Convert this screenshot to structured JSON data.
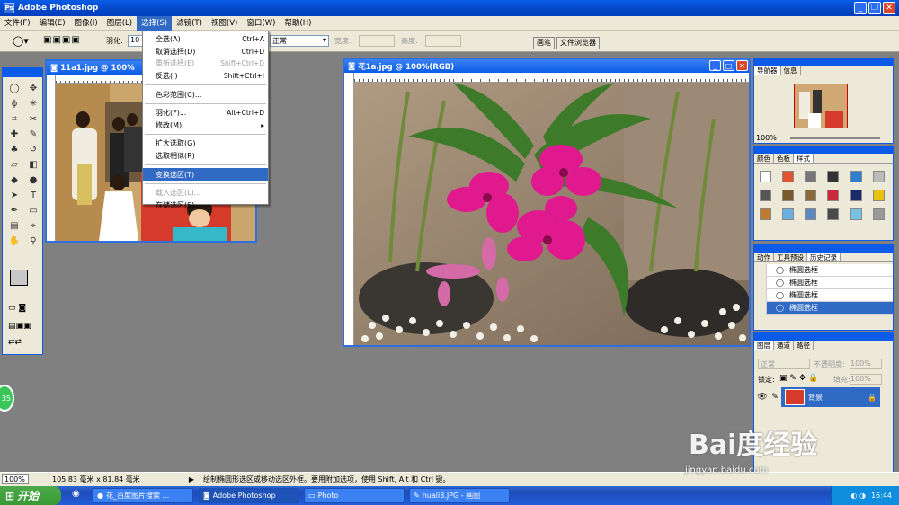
{
  "window": {
    "title": "Adobe Photoshop"
  },
  "menubar": [
    "文件(F)",
    "编辑(E)",
    "图像(I)",
    "图层(L)",
    "选择(S)",
    "滤镜(T)",
    "视图(V)",
    "窗口(W)",
    "帮助(H)"
  ],
  "options": {
    "feather_label": "羽化:",
    "feather_value": "10",
    "style_value": "正常",
    "width_label": "宽度:",
    "height_label": "高度:",
    "well_tabs": [
      "画笔",
      "文件浏览器"
    ]
  },
  "select_menu": [
    {
      "label": "全选(A)",
      "shortcut": "Ctrl+A",
      "disabled": false
    },
    {
      "label": "取消选择(D)",
      "shortcut": "Ctrl+D",
      "disabled": false
    },
    {
      "label": "重新选择(E)",
      "shortcut": "Shift+Ctrl+D",
      "disabled": true
    },
    {
      "label": "反选(I)",
      "shortcut": "Shift+Ctrl+I",
      "disabled": false
    },
    {
      "sep": true
    },
    {
      "label": "色彩范围(C)...",
      "shortcut": "",
      "disabled": false
    },
    {
      "sep": true
    },
    {
      "label": "羽化(F)...",
      "shortcut": "Alt+Ctrl+D",
      "disabled": false
    },
    {
      "label": "修改(M)",
      "shortcut": "▸",
      "disabled": false
    },
    {
      "sep": true
    },
    {
      "label": "扩大选取(G)",
      "shortcut": "",
      "disabled": false
    },
    {
      "label": "选取相似(R)",
      "shortcut": "",
      "disabled": false
    },
    {
      "sep": true
    },
    {
      "label": "变换选区(T)",
      "shortcut": "",
      "disabled": false,
      "highlight": true
    },
    {
      "sep": true
    },
    {
      "label": "载入选区(L)...",
      "shortcut": "",
      "disabled": true
    },
    {
      "label": "存储选区(S)...",
      "shortcut": "",
      "disabled": false
    }
  ],
  "doc1": {
    "title": "11a1.jpg @ 100%"
  },
  "doc2": {
    "title": "花1a.jpg @ 100%(RGB)"
  },
  "panels": {
    "navigator_tabs": [
      "导航器",
      "信息"
    ],
    "navigator_zoom": "100%",
    "swatch_tabs": [
      "颜色",
      "色板",
      "样式"
    ],
    "history_tabs": [
      "动作",
      "工具预设",
      "历史记录"
    ],
    "history_items": [
      "椭圆选框",
      "椭圆选框",
      "椭圆选框",
      "椭圆选框"
    ],
    "layer_tabs": [
      "图层",
      "通道",
      "路径"
    ],
    "blend_mode": "正常",
    "opacity_label": "不透明度:",
    "opacity_value": "100%",
    "lock_label": "锁定:",
    "fill_label": "填充:",
    "fill_value": "100%",
    "layer_name": "背景"
  },
  "status": {
    "zoom": "100%",
    "size": "105.83 毫米 x 81.84 毫米",
    "hint": "绘制椭圆形选区或移动选区外框。要用附加选项，使用 Shift, Alt 和 Ctrl 键。"
  },
  "taskbar": {
    "start": "开始",
    "tasks": [
      "花_百度图片搜索 ...",
      "Adobe Photoshop",
      "Photo",
      "huali3.JPG - 画图"
    ],
    "clock": "16:44"
  },
  "watermark": {
    "brand": "Bai度经验",
    "url": "jingyan.baidu.com"
  },
  "colors": {
    "accent": "#0a5ce8",
    "menu_highlight": "#316ac5",
    "orchid": "#e0198f"
  }
}
